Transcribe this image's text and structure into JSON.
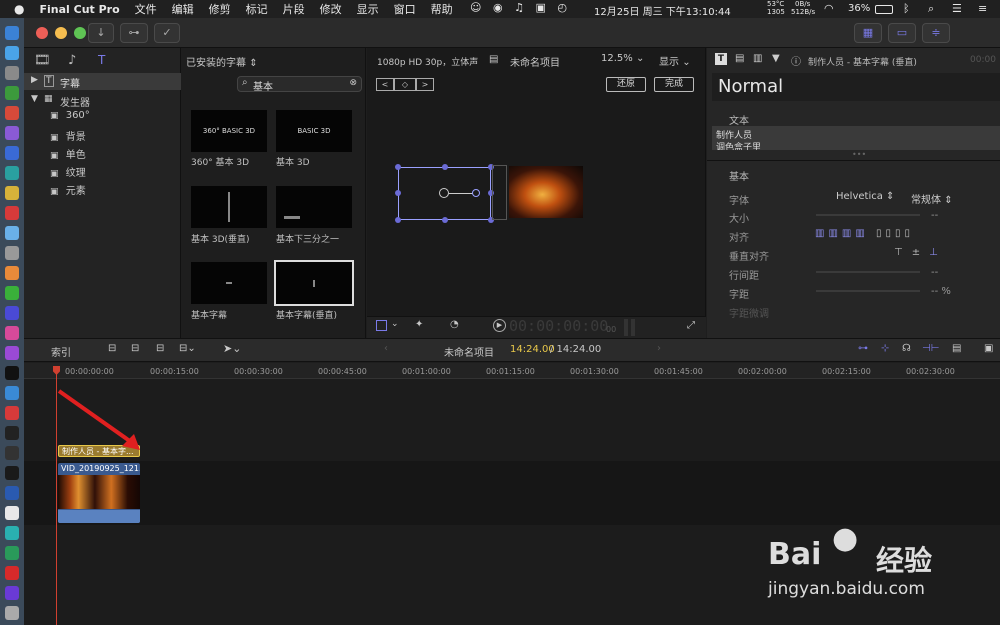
{
  "menubar": {
    "app": "Final Cut Pro",
    "items": [
      "文件",
      "编辑",
      "修剪",
      "标记",
      "片段",
      "修改",
      "显示",
      "窗口",
      "帮助"
    ],
    "cpu": "53°C",
    "rpm": "1305",
    "net_up": "0B/s",
    "net_down": "512B/s",
    "battery": "36%",
    "datetime": "12月25日 周三 下午13:10:44"
  },
  "sidebar": {
    "items": [
      {
        "label": "字幕"
      },
      {
        "label": "发生器"
      },
      {
        "label": "360°"
      },
      {
        "label": "背景"
      },
      {
        "label": "单色"
      },
      {
        "label": "纹理"
      },
      {
        "label": "元素"
      }
    ]
  },
  "browser": {
    "category": "已安装的字幕",
    "search": "基本",
    "items": [
      {
        "label": "360° 基本 3D",
        "thumb": "360° BASIC 3D"
      },
      {
        "label": "基本 3D",
        "thumb": "BASIC 3D"
      },
      {
        "label": "基本 3D(垂直)",
        "thumb": ""
      },
      {
        "label": "基本下三分之一",
        "thumb": ""
      },
      {
        "label": "基本字幕",
        "thumb": ""
      },
      {
        "label": "基本字幕(垂直)",
        "thumb": ""
      }
    ]
  },
  "viewer": {
    "format": "1080p HD 30p，立体声",
    "project": "未命名项目",
    "zoom": "12.5%",
    "display": "显示",
    "revert": "还原",
    "done": "完成",
    "timecode": "00:00:00:00",
    "timecode_frames": "00"
  },
  "inspector": {
    "title": "制作人员 - 基本字幕 (垂直)",
    "time": "00:00",
    "preset": "Normal",
    "section_text": "文本",
    "text_lines": [
      "制作人员",
      "调色盒子里"
    ],
    "section_basic": "基本",
    "font_label": "字体",
    "font": "Helvetica",
    "style": "常规体",
    "size_label": "大小",
    "size_val": "--",
    "align_label": "对齐",
    "valign_label": "垂直对齐",
    "line_label": "行间距",
    "line_val": "--",
    "track_label": "字距",
    "track_val": "-- %",
    "kern_label": "字距微调"
  },
  "timeline": {
    "index": "索引",
    "project": "未命名项目",
    "duration": "14:24.00",
    "total": "/ 14:24.00",
    "ticks": [
      "00:00:00:00",
      "00:00:15:00",
      "00:00:30:00",
      "00:00:45:00",
      "00:01:00:00",
      "00:01:15:00",
      "00:01:30:00",
      "00:01:45:00",
      "00:02:00:00",
      "00:02:15:00",
      "00:02:30:00"
    ],
    "title_clip": "制作人员 - 基本字...",
    "video_clip": "VID_20190925_121..."
  },
  "watermark": {
    "brand": "Bai",
    "brand2": "经验",
    "url": "jingyan.baidu.com"
  },
  "colors": {
    "accent": "#6b6bd6",
    "title_clip": "#9a7b2f",
    "video_clip": "#3a5a8f",
    "arrow": "#e02020"
  }
}
